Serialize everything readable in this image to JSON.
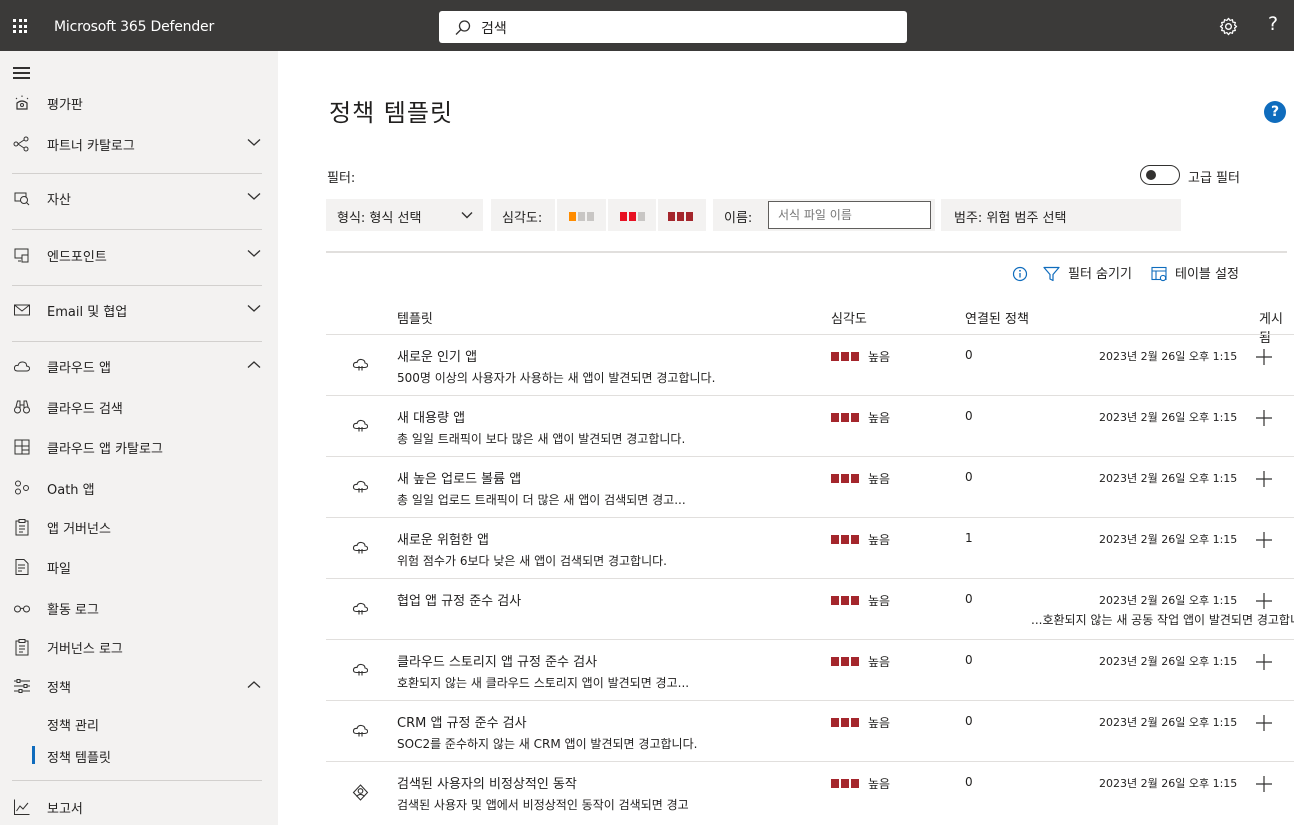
{
  "topbar": {
    "app_title": "Microsoft 365 Defender",
    "search_placeholder": "검색",
    "icons": [
      "waffle-icon",
      "search-icon",
      "gear-icon",
      "help-icon"
    ],
    "help_glyph": "?"
  },
  "sidebar": {
    "items": [
      {
        "label": "평가판",
        "icon": "trial-icon"
      },
      {
        "label": "파트너 카탈로그",
        "icon": "partner-icon"
      },
      {
        "label": "자산",
        "icon": "assets-icon"
      },
      {
        "label": "엔드포인트",
        "icon": "endpoint-icon"
      },
      {
        "label": "Email 및 협업",
        "icon": "mail-icon"
      },
      {
        "label": "클라우드 앱",
        "icon": "cloud-icon"
      },
      {
        "label": "클라우드 검색",
        "icon": "binoculars-icon"
      },
      {
        "label": "클라우드 앱 카탈로그",
        "icon": "catalog-icon"
      },
      {
        "label": "Oath 앱",
        "icon": "oauth-icon"
      },
      {
        "label": "앱 거버넌스",
        "icon": "governance-icon"
      },
      {
        "label": "파일",
        "icon": "file-icon"
      },
      {
        "label": "활동 로그",
        "icon": "glasses-icon"
      },
      {
        "label": "거버넌스 로그",
        "icon": "clipboard-icon"
      },
      {
        "label": "정책",
        "icon": "policy-icon"
      },
      {
        "label": "보고서",
        "icon": "report-icon"
      }
    ],
    "sub_items": [
      {
        "label": "정책 관리"
      },
      {
        "label": "정책 템플릿"
      }
    ]
  },
  "main": {
    "title": "정책 템플릿",
    "help_glyph": "?",
    "filter_label": "필터:",
    "advanced_filter_label": "고급 필터",
    "type_filter": "형식: 형식 선택",
    "severity_filter_label": "심각도:",
    "name_filter_label": "이름:",
    "name_filter_placeholder": "서식 파일 이름",
    "category_filter": "범주: 위험 범주 선택",
    "toolbar": {
      "hide_filters": "필터 숨기기",
      "table_settings": "테이블 설정"
    },
    "columns": [
      "템플릿",
      "심각도",
      "연결된 정책",
      "게시됨"
    ],
    "rows": [
      {
        "icon": "cloud-policy-icon",
        "title": "새로운 인기 앱",
        "desc": "500명 이상의 사용자가 사용하는 새 앱이 발견되면 경고합니다.",
        "severity": "높음",
        "linked": "0",
        "date": "2023년 2월 26일 오후 1:15",
        "overflow": ""
      },
      {
        "icon": "cloud-policy-icon",
        "title": "새 대용량 앱",
        "desc": "총 일일 트래픽이 보다 많은 새 앱이 발견되면 경고합니다.",
        "severity": "높음",
        "linked": "0",
        "date": "2023년 2월 26일 오후 1:15",
        "overflow": ""
      },
      {
        "icon": "cloud-policy-icon",
        "title": "새 높은 업로드 볼륨 앱",
        "desc": "총 일일 업로드 트래픽이 더 많은 새 앱이 검색되면 경고...",
        "severity": "높음",
        "linked": "0",
        "date": "2023년 2월 26일 오후 1:15",
        "overflow": ""
      },
      {
        "icon": "cloud-policy-icon",
        "title": "새로운 위험한 앱",
        "desc": "위험 점수가 6보다 낮은 새 앱이 검색되면 경고합니다.",
        "severity": "높음",
        "linked": "1",
        "date": "2023년 2월 26일 오후 1:15",
        "overflow": ""
      },
      {
        "icon": "cloud-policy-icon",
        "title": "협업 앱 규정 준수 검사",
        "desc": "",
        "severity": "높음",
        "linked": "0",
        "date": "2023년 2월 26일 오후 1:15",
        "overflow": "...호환되지 않는 새 공동 작업 앱이 발견되면 경고합니다."
      },
      {
        "icon": "cloud-policy-icon",
        "title": "클라우드 스토리지 앱 규정 준수 검사",
        "desc": "호환되지 않는 새 클라우드 스토리지 앱이 발견되면 경고...",
        "severity": "높음",
        "linked": "0",
        "date": "2023년 2월 26일 오후 1:15",
        "overflow": ""
      },
      {
        "icon": "cloud-policy-icon",
        "title": "CRM 앱 규정 준수 검사",
        "desc": "SOC2를 준수하지 않는 새 CRM 앱이 발견되면 경고합니다.",
        "severity": "높음",
        "linked": "0",
        "date": "2023년 2월 26일 오후 1:15",
        "overflow": ""
      },
      {
        "icon": "anomaly-policy-icon",
        "title": "검색된 사용자의 비정상적인 동작",
        "desc": "검색된 사용자 및 앱에서 비정상적인 동작이 검색되면 경고",
        "severity": "높음",
        "linked": "0",
        "date": "2023년 2월 26일 오후 1:15",
        "overflow": ""
      }
    ]
  },
  "colors": {
    "topbar_bg": "#3b3a39",
    "sidebar_bg": "#f3f2f1",
    "accent": "#0f6cbd",
    "severity_high": "#a4262c",
    "severity_medium": "#e81123",
    "severity_low": "#ff8c00"
  }
}
